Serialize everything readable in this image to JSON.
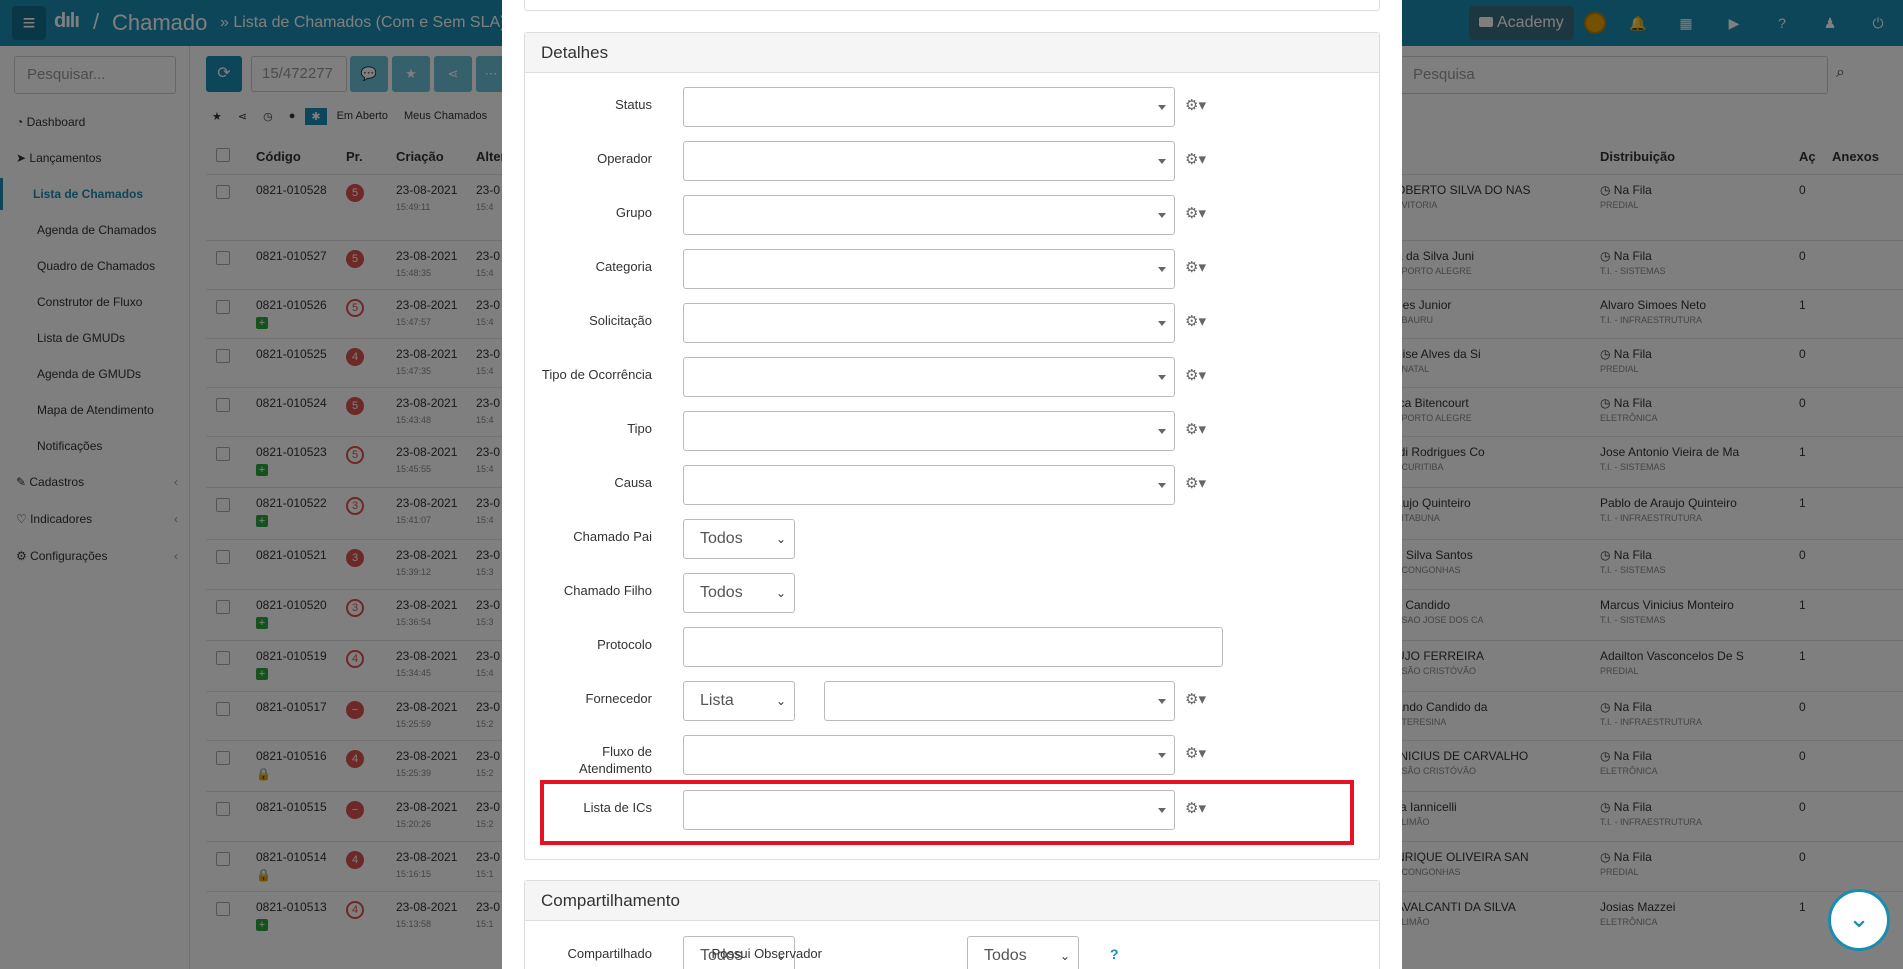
{
  "topbar": {
    "logo": "dılı",
    "slash": "/",
    "app_title": "Chamado",
    "breadcrumb": "» Lista de Chamados (Com e Sem SLA)",
    "academy_label": "Academy"
  },
  "sidebar": {
    "search_placeholder": "Pesquisar...",
    "items": [
      {
        "label": "Dashboard",
        "icon": "dashboard-icon"
      },
      {
        "label": "Lançamentos",
        "icon": "send-icon"
      },
      {
        "label": "Lista de Chamados"
      },
      {
        "label": "Agenda de Chamados"
      },
      {
        "label": "Quadro de Chamados"
      },
      {
        "label": "Construtor de Fluxo"
      },
      {
        "label": "Lista de GMUDs"
      },
      {
        "label": "Agenda de GMUDs"
      },
      {
        "label": "Mapa de Atendimento"
      },
      {
        "label": "Notificações"
      },
      {
        "label": "Cadastros",
        "icon": "edit-icon"
      },
      {
        "label": "Indicadores",
        "icon": "heart-icon"
      },
      {
        "label": "Configurações",
        "icon": "gear-icon"
      }
    ]
  },
  "toolbar": {
    "pager": "15/472277",
    "search_placeholder": "Pesquisa"
  },
  "filters": [
    "Em Aberto",
    "Meus Chamados"
  ],
  "table": {
    "headers": {
      "codigo": "Código",
      "pr": "Pr.",
      "criacao": "Criação",
      "alter": "Alter",
      "distribuicao": "Distribuição",
      "ac": "Aç",
      "anexos": "Anexos"
    },
    "rows": [
      {
        "codigo": "0821-010528",
        "pr": "5",
        "pr_outline": false,
        "date": "23-08-2021",
        "time": "15:49:11",
        "alt": "23-0",
        "alt_time": "15:4",
        "solic": "OBERTO SILVA DO NAS",
        "solic_sub": "- VITORIA",
        "dist": "Na Fila",
        "dist_sub": "PREDIAL",
        "ac": "0",
        "plus": false,
        "lock": false
      },
      {
        "codigo": "0821-010527",
        "pr": "5",
        "pr_outline": false,
        "date": "23-08-2021",
        "time": "15:48:35",
        "alt": "23-0",
        "alt_time": "15:4",
        "solic": "a da Silva Juni",
        "solic_sub": "- PORTO ALEGRE",
        "dist": "Na Fila",
        "dist_sub": "T.I. - SISTEMAS",
        "ac": "0",
        "plus": false,
        "lock": false
      },
      {
        "codigo": "0821-010526",
        "pr": "5",
        "pr_outline": true,
        "date": "23-08-2021",
        "time": "15:47:57",
        "alt": "23-0",
        "alt_time": "15:4",
        "solic": "oes Junior",
        "solic_sub": "- BAURU",
        "dist": "Alvaro Simoes Neto",
        "dist_sub": "T.I. - INFRAESTRUTURA",
        "ac": "1",
        "plus": true,
        "lock": false
      },
      {
        "codigo": "0821-010525",
        "pr": "4",
        "pr_outline": false,
        "date": "23-08-2021",
        "time": "15:47:35",
        "alt": "23-0",
        "alt_time": "15:4",
        "solic": "eise Alves da Si",
        "solic_sub": "- NATAL",
        "dist": "Na Fila",
        "dist_sub": "PREDIAL",
        "ac": "0",
        "plus": false,
        "lock": false
      },
      {
        "codigo": "0821-010524",
        "pr": "5",
        "pr_outline": false,
        "date": "23-08-2021",
        "time": "15:43:48",
        "alt": "23-0",
        "alt_time": "15:4",
        "solic": "ica Bitencourt",
        "solic_sub": "- PORTO ALEGRE",
        "dist": "Na Fila",
        "dist_sub": "ELETRÔNICA",
        "ac": "0",
        "plus": false,
        "lock": false
      },
      {
        "codigo": "0821-010523",
        "pr": "5",
        "pr_outline": true,
        "date": "23-08-2021",
        "time": "15:45:55",
        "alt": "23-0",
        "alt_time": "15:4",
        "solic": "ldi Rodrigues Co",
        "solic_sub": "- CURITIBA",
        "dist": "Jose Antonio Vieira de Ma",
        "dist_sub": "T.I. - SISTEMAS",
        "ac": "1",
        "plus": true,
        "lock": false
      },
      {
        "codigo": "0821-010522",
        "pr": "3",
        "pr_outline": true,
        "date": "23-08-2021",
        "time": "15:41:07",
        "alt": "23-0",
        "alt_time": "15:4",
        "solic": "aujo Quinteiro",
        "solic_sub": "- ITABUNA",
        "dist": "Pablo de Araujo Quinteiro",
        "dist_sub": "T.I. - INFRAESTRUTURA",
        "ac": "1",
        "plus": true,
        "lock": false
      },
      {
        "codigo": "0821-010521",
        "pr": "3",
        "pr_outline": false,
        "date": "23-08-2021",
        "time": "15:39:12",
        "alt": "23-0",
        "alt_time": "15:3",
        "solic": "n Silva Santos",
        "solic_sub": "- CONGONHAS",
        "dist": "Na Fila",
        "dist_sub": "T.I. - SISTEMAS",
        "ac": "0",
        "plus": false,
        "lock": false
      },
      {
        "codigo": "0821-010520",
        "pr": "3",
        "pr_outline": true,
        "date": "23-08-2021",
        "time": "15:36:54",
        "alt": "23-0",
        "alt_time": "15:3",
        "solic": "s Candido",
        "solic_sub": "- SAO JOSE DOS CA",
        "dist": "Marcus Vinicius Monteiro",
        "dist_sub": "T.I. - SISTEMAS",
        "ac": "1",
        "plus": true,
        "lock": false
      },
      {
        "codigo": "0821-010519",
        "pr": "4",
        "pr_outline": true,
        "date": "23-08-2021",
        "time": "15:34:45",
        "alt": "23-0",
        "alt_time": "15:4",
        "solic": "UJO FERREIRA",
        "solic_sub": "- SÃO CRISTÓVÃO",
        "dist": "Adailton Vasconcelos De S",
        "dist_sub": "PREDIAL",
        "ac": "1",
        "plus": true,
        "lock": false
      },
      {
        "codigo": "0821-010517",
        "pr": "−",
        "pr_outline": false,
        "date": "23-08-2021",
        "time": "15:25:59",
        "alt": "23-0",
        "alt_time": "15:2",
        "solic": "ando Candido da",
        "solic_sub": "- TERESINA",
        "dist": "Na Fila",
        "dist_sub": "T.I. - INFRAESTRUTURA",
        "ac": "0",
        "plus": false,
        "lock": false
      },
      {
        "codigo": "0821-010516",
        "pr": "4",
        "pr_outline": false,
        "date": "23-08-2021",
        "time": "15:25:39",
        "alt": "23-0",
        "alt_time": "15:2",
        "solic": "INICIUS DE CARVALHO",
        "solic_sub": "- SÃO CRISTÓVÃO",
        "dist": "Na Fila",
        "dist_sub": "ELETRÔNICA",
        "ac": "0",
        "plus": false,
        "lock": true
      },
      {
        "codigo": "0821-010515",
        "pr": "−",
        "pr_outline": false,
        "date": "23-08-2021",
        "time": "15:20:26",
        "alt": "23-0",
        "alt_time": "15:2",
        "solic": "ra Iannicelli",
        "solic_sub": "- LIMÃO",
        "dist": "Na Fila",
        "dist_sub": "T.I. - INFRAESTRUTURA",
        "ac": "0",
        "plus": false,
        "lock": false
      },
      {
        "codigo": "0821-010514",
        "pr": "4",
        "pr_outline": false,
        "date": "23-08-2021",
        "time": "15:16:15",
        "alt": "23-0",
        "alt_time": "15:1",
        "solic": "NRIQUE OLIVEIRA SAN",
        "solic_sub": "- CONGONHAS",
        "dist": "Na Fila",
        "dist_sub": "PREDIAL",
        "ac": "0",
        "plus": false,
        "lock": true
      },
      {
        "codigo": "0821-010513",
        "pr": "4",
        "pr_outline": true,
        "date": "23-08-2021",
        "time": "15:13:58",
        "alt": "23-0",
        "alt_time": "15:1",
        "solic": "AVALCANTI DA SILVA",
        "solic_sub": "- LIMÃO",
        "dist": "Josias Mazzei",
        "dist_sub": "ELETRÔNICA",
        "ac": "1",
        "plus": true,
        "lock": false
      }
    ]
  },
  "modal": {
    "detalhes_title": "Detalhes",
    "fields": [
      {
        "label": "Status"
      },
      {
        "label": "Operador"
      },
      {
        "label": "Grupo"
      },
      {
        "label": "Categoria"
      },
      {
        "label": "Solicitação"
      },
      {
        "label": "Tipo de Ocorrência"
      },
      {
        "label": "Tipo"
      },
      {
        "label": "Causa"
      }
    ],
    "chamado_pai_label": "Chamado Pai",
    "chamado_pai_value": "Todos",
    "chamado_filho_label": "Chamado Filho",
    "chamado_filho_value": "Todos",
    "protocolo_label": "Protocolo",
    "fornecedor_label": "Fornecedor",
    "fornecedor_value": "Lista",
    "fluxo_label_1": "Fluxo de",
    "fluxo_label_2": "Atendimento",
    "lista_ics_label": "Lista de ICs",
    "compartilhamento_title": "Compartilhamento",
    "compartilhado_label": "Compartilhado",
    "compartilhado_value": "Todos",
    "possui_observador_label": "Possui Observador",
    "possui_observador_value": "Todos",
    "help_text": "?"
  },
  "colors": {
    "primary": "#1a8cb0",
    "highlight": "#e81123",
    "priority": "#d9534f"
  }
}
